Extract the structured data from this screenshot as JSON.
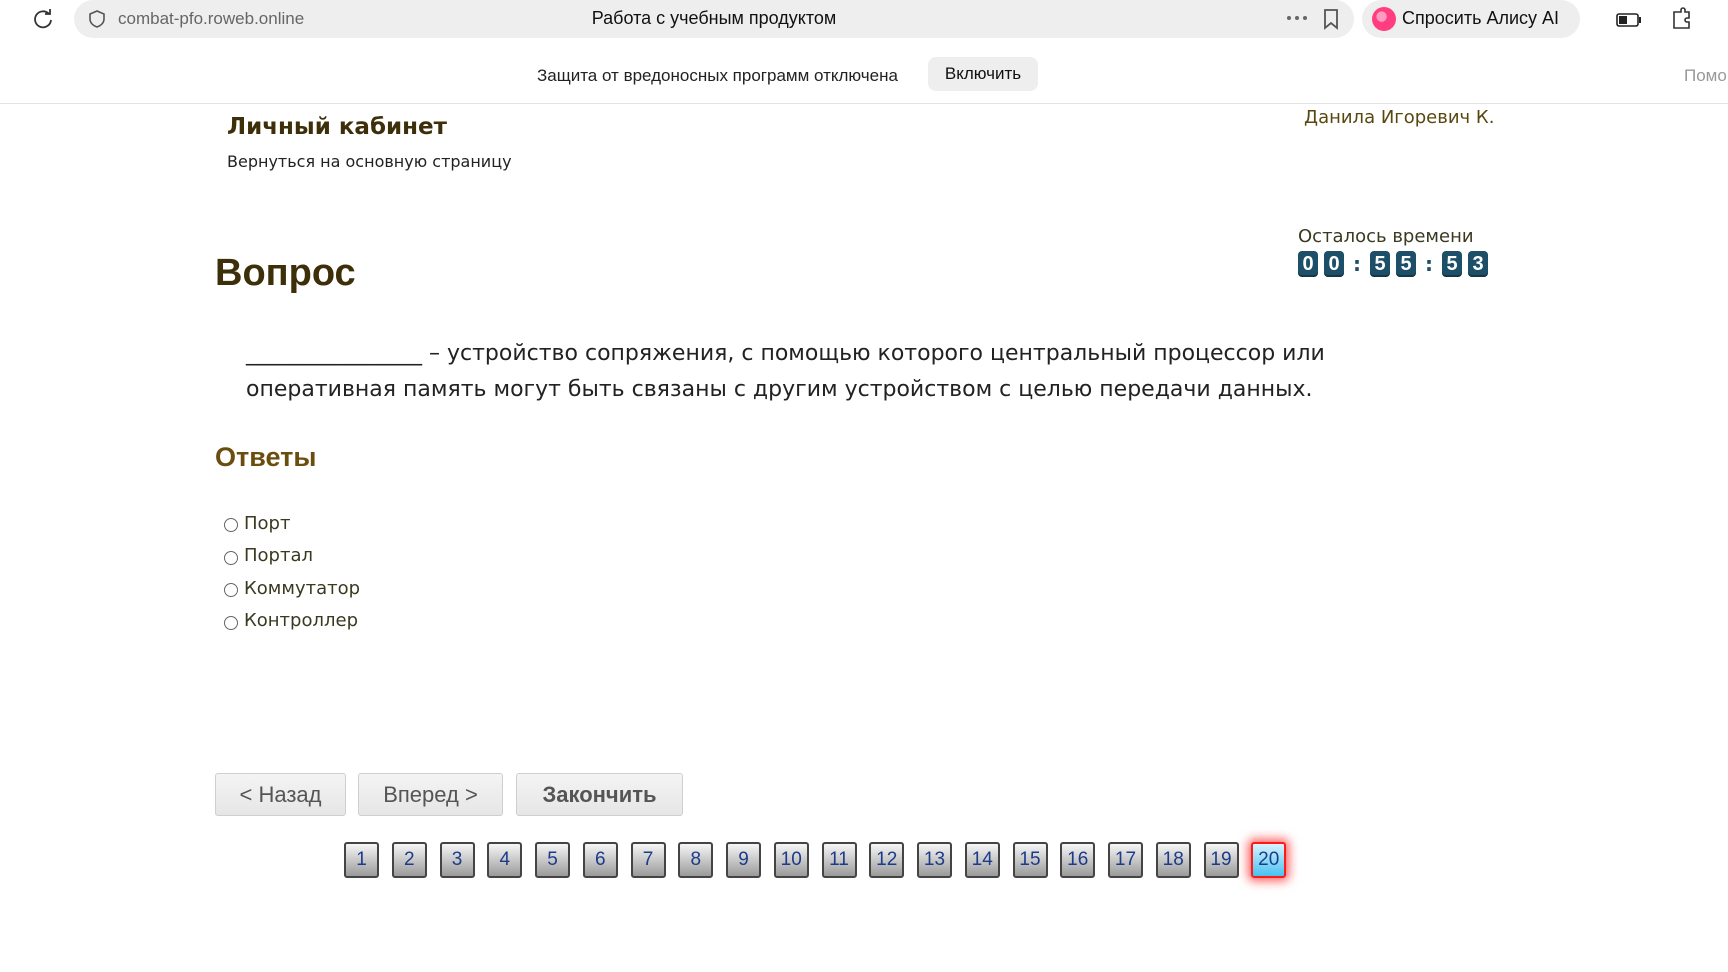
{
  "browser": {
    "url": "combat-pfo.roweb.online",
    "tab_title": "Работа с учебным продуктом",
    "alice_label": "Спросить Алису AI"
  },
  "infobar": {
    "message": "Защита от вредоносных программ отключена",
    "enable_label": "Включить",
    "help_label": "Помо"
  },
  "header": {
    "title": "Личный кабинет",
    "back_link": "Вернуться на основную страницу",
    "user": "Данила Игоревич К."
  },
  "timer": {
    "label": "Осталось времени",
    "digits": [
      "0",
      "0",
      "5",
      "5",
      "5",
      "3"
    ],
    "separator": ":"
  },
  "question": {
    "heading": "Вопрос",
    "text": "________________ – устройство сопряжения, с помощью которого центральный процессор или оперативная память могут быть связаны с другим устройством с целью передачи данных."
  },
  "answers": {
    "heading": "Ответы",
    "options": [
      "Порт",
      "Портал",
      "Коммутатор",
      "Контроллер"
    ]
  },
  "nav": {
    "back_label": "< Назад",
    "forward_label": "Вперед >",
    "finish_label": "Закончить"
  },
  "pager": {
    "pages": [
      "1",
      "2",
      "3",
      "4",
      "5",
      "6",
      "7",
      "8",
      "9",
      "10",
      "11",
      "12",
      "13",
      "14",
      "15",
      "16",
      "17",
      "18",
      "19",
      "20"
    ],
    "current": "20"
  },
  "colors": {
    "heading_brown": "#3d2f0a",
    "timer_digit_bg": "#1e4f68",
    "active_page_border": "#ff1a1a",
    "active_page_fill": "#49c2f0"
  }
}
